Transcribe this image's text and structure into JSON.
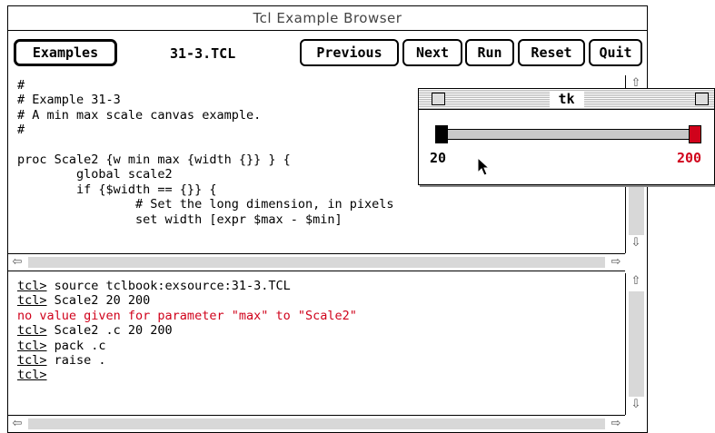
{
  "window": {
    "title": "Tcl Example Browser"
  },
  "toolbar": {
    "examples_label": "Examples",
    "file_label": "31-3.TCL",
    "previous_label": "Previous",
    "next_label": "Next",
    "run_label": "Run",
    "reset_label": "Reset",
    "quit_label": "Quit"
  },
  "source": {
    "lines": [
      "#",
      "# Example 31-3",
      "# A min max scale canvas example.",
      "#",
      "",
      "proc Scale2 {w min max {width {}} } {",
      "        global scale2",
      "        if {$width == {}} {",
      "                # Set the long dimension, in pixels",
      "                set width [expr $max - $min]"
    ]
  },
  "console": {
    "lines": [
      {
        "prompt": "tcl>",
        "text": " source tclbook:exsource:31-3.TCL",
        "error": false
      },
      {
        "prompt": "tcl>",
        "text": " Scale2 20 200",
        "error": false
      },
      {
        "prompt": "",
        "text": "no value given for parameter \"max\" to \"Scale2\"",
        "error": true
      },
      {
        "prompt": "tcl>",
        "text": " Scale2 .c 20 200",
        "error": false
      },
      {
        "prompt": "tcl>",
        "text": " pack .c",
        "error": false
      },
      {
        "prompt": "tcl>",
        "text": " raise .",
        "error": false
      },
      {
        "prompt": "tcl>",
        "text": "",
        "error": false
      }
    ]
  },
  "tk_window": {
    "title": "tk",
    "min_label": "20",
    "max_label": "200",
    "min_value": 20,
    "max_value": 200
  },
  "colors": {
    "error": "#d0021b",
    "max_marker": "#d0021b",
    "min_marker": "#000000"
  }
}
